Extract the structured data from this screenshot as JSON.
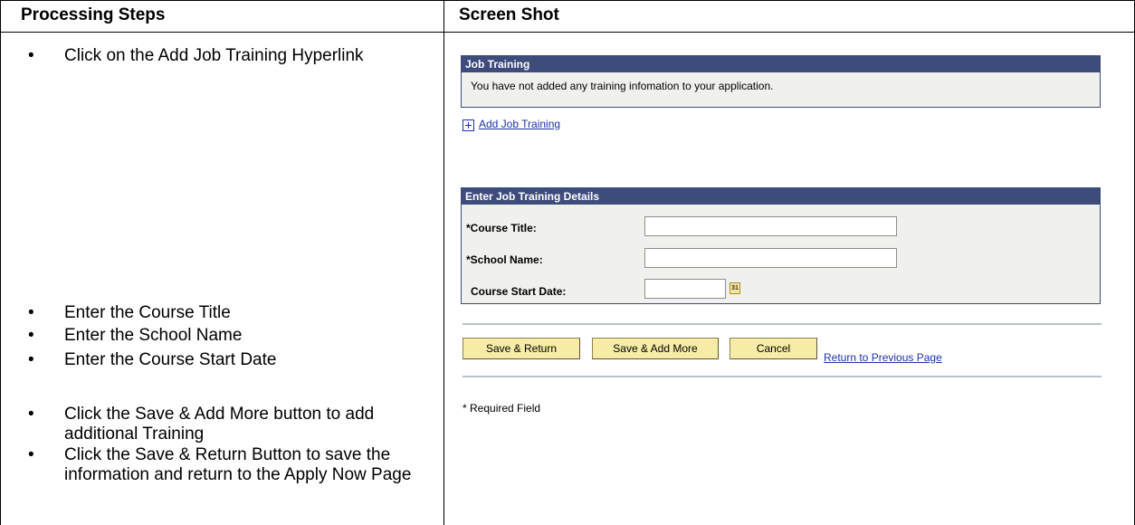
{
  "header": {
    "left": "Processing Steps",
    "right": "Screen Shot"
  },
  "steps": [
    {
      "bullet": "•",
      "text": "Click on the Add Job Training Hyperlink"
    },
    {
      "bullet": "•",
      "text": "Enter the Course Title"
    },
    {
      "bullet": "•",
      "text": "Enter the School Name"
    },
    {
      "bullet": "•",
      "text": "Enter the Course Start Date"
    },
    {
      "bullet": "•",
      "text": "Click the Save & Add More button to add additional Training"
    },
    {
      "bullet": "•",
      "text": "Click the Save & Return Button to save the information and return to the Apply Now Page"
    }
  ],
  "job_training": {
    "title": "Job Training",
    "message": "You have not added any training infomation to your application.",
    "add_link": "Add Job Training"
  },
  "details": {
    "title": "Enter Job Training Details",
    "fields": [
      {
        "label": "*Course Title:",
        "value": ""
      },
      {
        "label": "*School Name:",
        "value": ""
      },
      {
        "label": "Course Start Date:",
        "value": ""
      }
    ],
    "calendar_icon_text": "31"
  },
  "buttons": {
    "save_return": "Save & Return",
    "save_add_more": "Save & Add More",
    "cancel": "Cancel",
    "return_link": "Return to Previous Page"
  },
  "footnote": "* Required Field",
  "colors": {
    "panel_header": "#3e4c7c",
    "panel_body": "#f0f1ec",
    "button_bg": "#f6eca5",
    "link": "#1c33a8"
  }
}
